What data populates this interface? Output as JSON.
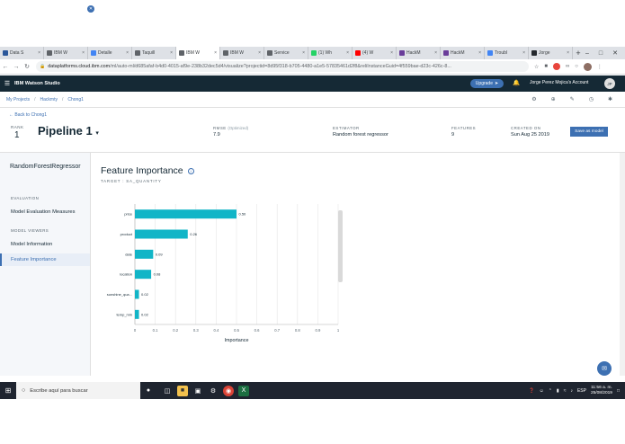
{
  "browser": {
    "tabs": [
      {
        "label": "Data S",
        "color": "#2b579a",
        "icon": "word-icon"
      },
      {
        "label": "IBM W",
        "color": "#5f6368",
        "icon": "ibm-icon"
      },
      {
        "label": "Detalle",
        "color": "#4285f4",
        "icon": "cloud-icon"
      },
      {
        "label": "Taquill",
        "color": "#5f6368",
        "icon": "doc-icon"
      },
      {
        "label": "IBM W",
        "color": "#5f6368",
        "icon": "ibm-icon"
      },
      {
        "label": "IBM W",
        "color": "#5f6368",
        "icon": "ibm-icon"
      },
      {
        "label": "Service",
        "color": "#5f6368",
        "icon": "gear-icon"
      },
      {
        "label": "(1) Wh",
        "color": "#25d366",
        "icon": "whatsapp-icon"
      },
      {
        "label": "(4) W",
        "color": "#ff0000",
        "icon": "youtube-icon"
      },
      {
        "label": "HackM",
        "color": "#6a3d9a",
        "icon": "hackmty-icon"
      },
      {
        "label": "HackM",
        "color": "#6a3d9a",
        "icon": "hackmty-icon"
      },
      {
        "label": "Troubl",
        "color": "#4285f4",
        "icon": "cloud-icon"
      },
      {
        "label": "Jorge",
        "color": "#24292e",
        "icon": "github-icon"
      }
    ],
    "active_tab": 4,
    "url_domain": "dataplatforms.cloud.ibm.com",
    "url_path": "/ml/auto-ml/d685afaf-b4d0-4015-af9e-238b32dec5d4/visualize?projectid=8d95f318-b705-4480-a1e5-57835461d2f8&reliInstanceGuid=4f559bae-d23c-426c-8..."
  },
  "app": {
    "brand": "IBM Watson Studio",
    "upgrade_label": "Upgrade",
    "account_label": "Jorge Perez Mojica's Account",
    "avatar_initials": "JP"
  },
  "breadcrumb": [
    "My Projects",
    "Hackmty",
    "Chong1"
  ],
  "pipeline": {
    "back_label": "Back to Chong1",
    "rank_label": "RANK",
    "rank_value": "1",
    "title": "Pipeline 1",
    "rmse_label": "RMSE",
    "rmse_sub": "(Optimized)",
    "rmse_value": "7.9",
    "estimator_label": "ESTIMATOR",
    "estimator_value": "Random forest regressor",
    "features_label": "FEATURES",
    "features_value": "9",
    "created_label": "CREATED ON",
    "created_value": "Sun Aug 25 2019",
    "save_label": "Save as model"
  },
  "sidebar": {
    "title": "RandomForestRegressor",
    "section_evaluation": "EVALUATION",
    "item_evaluation": "Model Evaluation Measures",
    "section_views": "MODEL VIEWERS",
    "item_info": "Model Information",
    "item_feature": "Feature Importance"
  },
  "main": {
    "title": "Feature Importance",
    "target_label": "TARGET : SA_QUANTITY"
  },
  "chart_data": {
    "type": "bar",
    "orientation": "horizontal",
    "categories": [
      "price",
      "product",
      "date",
      "location",
      "sunshine_qua...",
      "temp_min"
    ],
    "values": [
      0.5,
      0.26,
      0.09,
      0.08,
      0.02,
      0.02
    ],
    "value_labels": [
      "0.50",
      "0.26",
      "0.09",
      "0.08",
      "0.02",
      "0.02"
    ],
    "xlabel": "Importance",
    "xlim": [
      0,
      1
    ],
    "xticks": [
      "0",
      "0.1",
      "0.2",
      "0.3",
      "0.4",
      "0.5",
      "0.6",
      "0.7",
      "0.8",
      "0.9",
      "1"
    ],
    "grid": true,
    "bar_color": "#11b5c7"
  },
  "taskbar": {
    "search_placeholder": "Escribe aquí para buscar",
    "lang": "ESP",
    "time": "11:56 a. m.",
    "date": "25/08/2019"
  }
}
